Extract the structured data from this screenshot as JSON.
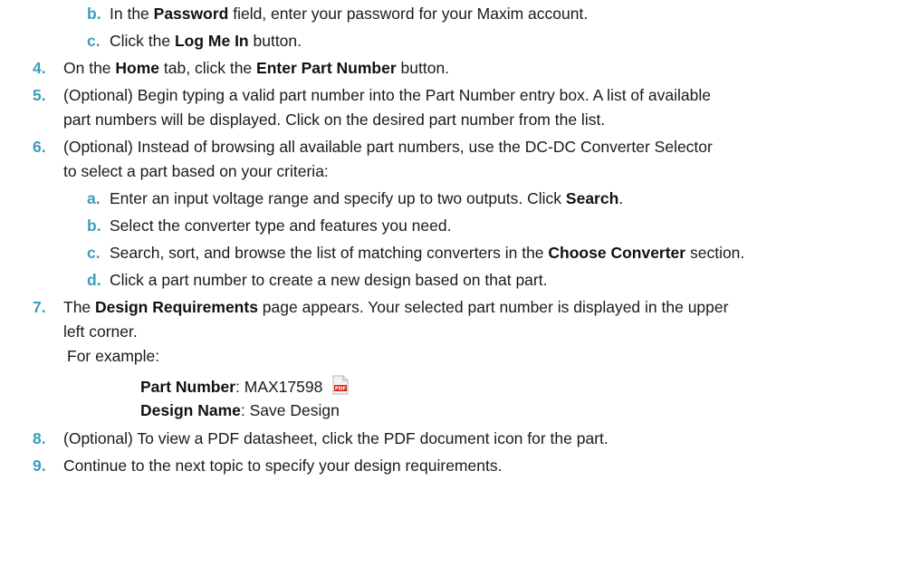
{
  "steps": {
    "s3b": {
      "marker": "b.",
      "pre": "In the ",
      "bold1": "Password",
      "post": " field, enter your password for your Maxim account."
    },
    "s3c": {
      "marker": "c.",
      "pre": "Click the ",
      "bold1": "Log Me In",
      "post": " button."
    },
    "s4": {
      "num": "4.",
      "pre": "On the ",
      "bold1": "Home",
      "mid": " tab, click the ",
      "bold2": "Enter Part Number",
      "post": " button."
    },
    "s5": {
      "num": "5.",
      "line1": "(Optional) Begin typing a valid part number into the Part Number entry box.  A list of available",
      "line2": "part numbers will be displayed.  Click on the desired part number from the list."
    },
    "s6": {
      "num": "6.",
      "line1": "(Optional) Instead of browsing all available part numbers, use the DC-DC Converter Selector",
      "line2": "to select a part based on your criteria:",
      "a": {
        "marker": "a.",
        "pre": "Enter an input voltage range and specify up to two outputs.  Click ",
        "bold1": "Search",
        "post": "."
      },
      "b": {
        "marker": "b.",
        "text": "Select the converter type and features you need."
      },
      "c": {
        "marker": "c.",
        "pre": "Search, sort, and browse the list of matching converters in the ",
        "bold1": "Choose Converter",
        "post": " section."
      },
      "d": {
        "marker": "d.",
        "text": "Click a part number to create a new design based on that part."
      }
    },
    "s7": {
      "num": "7.",
      "pre": "The ",
      "bold1": "Design Requirements",
      "post": " page appears. Your selected part number is displayed in the upper",
      "line2": "left corner.",
      "line3": "For example:",
      "part_label": "Part Number",
      "part_value": ": MAX17598",
      "design_label": "Design Name",
      "design_value": ": Save Design",
      "pdf_badge": "PDF"
    },
    "s8": {
      "num": "8.",
      "text": "(Optional) To view a PDF datasheet, click the PDF document icon for the part."
    },
    "s9": {
      "num": "9.",
      "text": "Continue to the next topic to specify your design requirements."
    }
  },
  "colors": {
    "accent": "#3c9dbd",
    "text": "#1a1a1a",
    "pdf_red": "#d9261c"
  }
}
